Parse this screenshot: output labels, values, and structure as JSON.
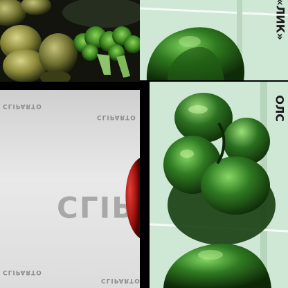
{
  "tiles": {
    "top_right": {
      "side_text": "«ЛИК»"
    },
    "bottom_left": {
      "small_text_1": "CLIPARTO",
      "small_text_2": "CLIPARTO",
      "small_text_3": "CLIPARTO",
      "small_text_4": "CLIPARTO",
      "big_text": "CLIPA"
    },
    "bottom_right": {
      "side_text": "ОЛС"
    }
  },
  "colors": {
    "mint": "#cfe8d5",
    "pepper_green": "#2f7a22",
    "pepper_dark": "#163d10",
    "sheet_grey": "#dcdcdc",
    "red_pepper": "#a4140f"
  }
}
